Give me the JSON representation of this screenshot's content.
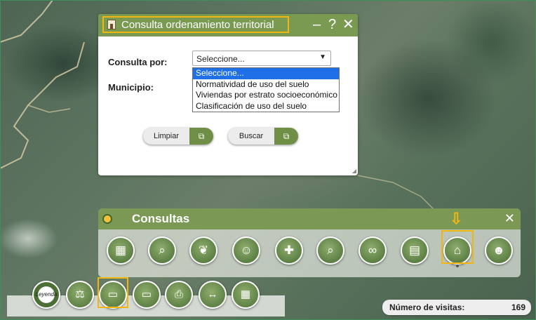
{
  "dialog": {
    "title": "Consulta ordenamiento territorial",
    "header_buttons": {
      "minimize": "–",
      "help": "?",
      "close": "✕"
    },
    "consulta_label": "Consulta por:",
    "municipio_label": "Municipio:",
    "select": {
      "value": "Seleccione...",
      "arrow": "▼",
      "options": [
        "Seleccione...",
        "Normatividad de uso del suelo",
        "Viviendas por estrato socioeconómico",
        "Clasificación de uso del suelo"
      ]
    },
    "buttons": {
      "clear": "Limpiar",
      "search": "Buscar",
      "button_icon": "⧉"
    }
  },
  "panel": {
    "title": "Consultas",
    "close": "✕",
    "tools": [
      {
        "icon": "map-search-icon",
        "glyph": "▦"
      },
      {
        "icon": "magnifier-icon",
        "glyph": "⌕"
      },
      {
        "icon": "parrot-icon",
        "glyph": "❦"
      },
      {
        "icon": "theater-masks-icon",
        "glyph": "☺"
      },
      {
        "icon": "doctor-icon",
        "glyph": "✚"
      },
      {
        "icon": "zoom-tool-icon",
        "glyph": "⌕"
      },
      {
        "icon": "binoculars-icon",
        "glyph": "∞"
      },
      {
        "icon": "building-icon",
        "glyph": "▤"
      },
      {
        "icon": "territory-document-icon",
        "glyph": "⌂"
      },
      {
        "icon": "people-icon",
        "glyph": "☻"
      }
    ],
    "highlight_arrow": "⇩"
  },
  "toolbar": {
    "tools": [
      {
        "icon": "legend-icon",
        "glyph": "Leyenda"
      },
      {
        "icon": "scale-icon",
        "glyph": "⚖"
      },
      {
        "icon": "folder-open-icon",
        "glyph": "▭"
      },
      {
        "icon": "folder-icon",
        "glyph": "▭"
      },
      {
        "icon": "print-icon",
        "glyph": "⎙"
      },
      {
        "icon": "measure-icon",
        "glyph": "↔"
      },
      {
        "icon": "map-grid-icon",
        "glyph": "▦"
      }
    ]
  },
  "visits": {
    "label": "Número de visitas:",
    "count": "169"
  },
  "colors": {
    "accent_green": "#7a9a52",
    "highlight": "#f1b611",
    "selected_option": "#1e6fe8"
  }
}
